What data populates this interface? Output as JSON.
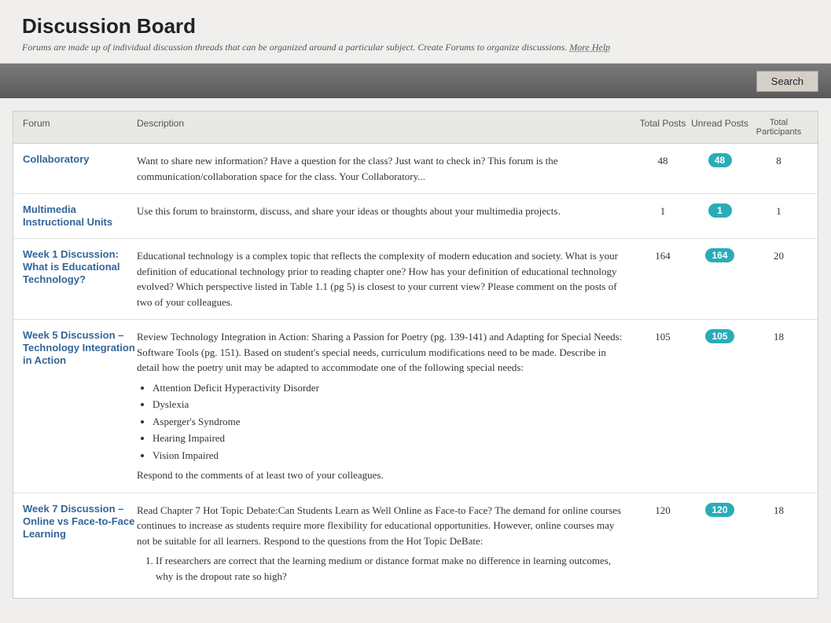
{
  "header": {
    "title": "Discussion Board",
    "subtitle": "Forums are made up of individual discussion threads that can be organized around a particular subject. Create Forums to organize discussions.",
    "more_help_label": "More Help"
  },
  "toolbar": {
    "search_label": "Search"
  },
  "table": {
    "columns": {
      "forum": "Forum",
      "description": "Description",
      "total_posts": "Total Posts",
      "unread_posts": "Unread Posts",
      "total_participants": "Total Participants"
    },
    "rows": [
      {
        "name": "Collaboratory",
        "description": "Want to share new information? Have a question for the class? Just want to check in? This forum is the communication/collaboration space for the class. Your Collaboratory...",
        "total_posts": 48,
        "unread_posts": 48,
        "total_participants": 8
      },
      {
        "name": "Multimedia Instructional Units",
        "description": "Use this forum to brainstorm, discuss, and share your ideas or thoughts about your multimedia projects.",
        "total_posts": 1,
        "unread_posts": 1,
        "total_participants": 1
      },
      {
        "name": "Week 1 Discussion: What is Educational Technology?",
        "description": "Educational technology is a complex topic that reflects the complexity of modern education and society. What is your definition of educational technology prior to reading chapter one?  How has your definition of educational technology evolved?  Which perspective listed in Table 1.1 (pg 5) is closest to your current view?  Please comment on the posts of two of your colleagues.",
        "total_posts": 164,
        "unread_posts": 164,
        "total_participants": 20
      },
      {
        "name": "Week 5 Discussion – Technology Integration in Action",
        "description_intro": "Review Technology Integration in Action: Sharing a Passion for Poetry (pg. 139-141) and Adapting for Special Needs: Software Tools (pg. 151). Based on student's special needs, curriculum modifications need to be made. Describe in detail how the poetry unit may be adapted to accommodate one of the following special needs:",
        "description_list": [
          "Attention Deficit Hyperactivity Disorder",
          "Dyslexia",
          "Asperger's Syndrome",
          "Hearing Impaired",
          "Vision Impaired"
        ],
        "description_outro": "Respond to the comments of at least two of your colleagues.",
        "total_posts": 105,
        "unread_posts": 105,
        "total_participants": 18
      },
      {
        "name": "Week 7 Discussion – Online vs Face-to-Face Learning",
        "description_intro": "Read Chapter 7 Hot Topic Debate:Can Students Learn as Well Online as Face-to Face? The demand for online courses continues to increase as students require more flexibility for educational opportunities. However, online courses may not be suitable for all learners.  Respond to the questions from the Hot Topic DeBate:",
        "description_list_ordered": [
          "If researchers are correct that the learning medium or distance format make no difference in learning outcomes, why is the dropout rate so high?"
        ],
        "total_posts": 120,
        "unread_posts": 120,
        "total_participants": 18
      }
    ]
  }
}
